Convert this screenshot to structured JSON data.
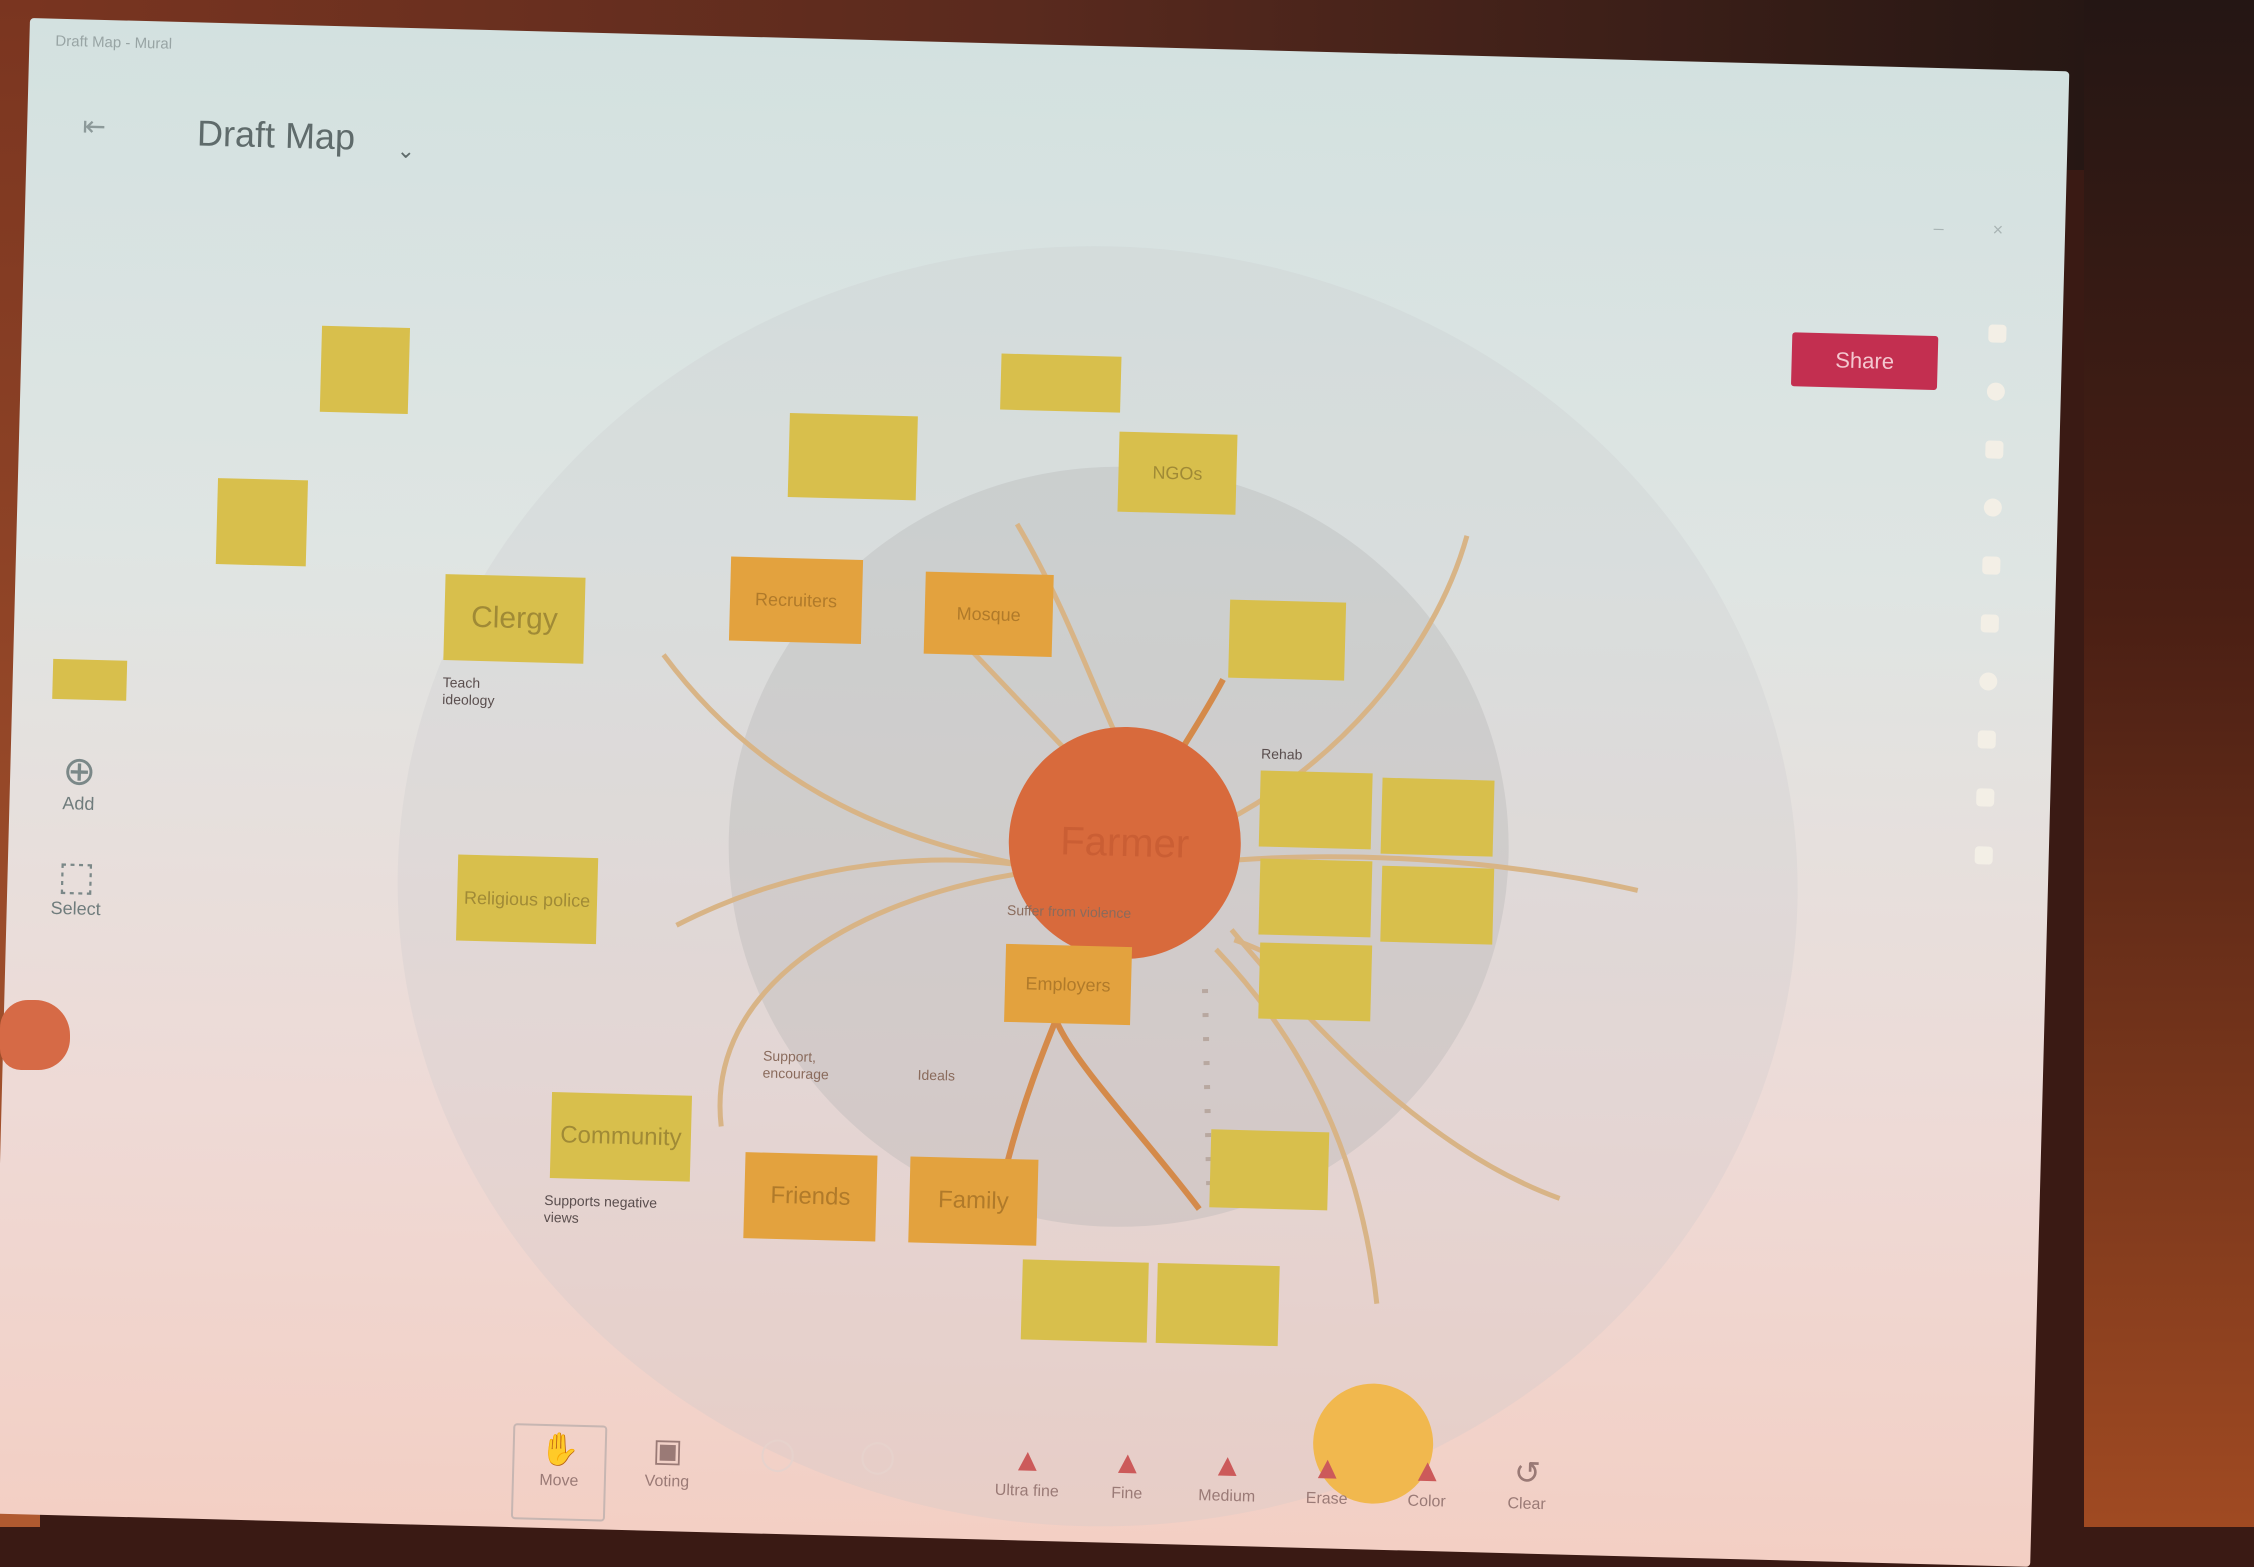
{
  "app": {
    "window_title": "Draft Map - Mural",
    "map_title": "Draft Map",
    "back_icon": "exit-icon",
    "share_button_label": "Share",
    "window_controls": "– ×"
  },
  "left_tools": [
    {
      "label": "Add",
      "icon": "⊕"
    },
    {
      "label": "Select",
      "icon": "⬚"
    }
  ],
  "right_rail_icons": [
    "page-icon",
    "refresh-icon",
    "note-icon",
    "heart-icon",
    "folder-icon",
    "chat-icon",
    "circle-icon",
    "arrow-icon",
    "palette-icon",
    "plus-icon",
    "settings-icon",
    "share-icon",
    "lock-icon",
    "pen-icon",
    "cut-icon",
    "zoom-icon",
    "info-icon"
  ],
  "center": {
    "label": "Farmer"
  },
  "notes": {
    "clergy": "Clergy",
    "religious_police": "Religious police",
    "community": "Community",
    "friends": "Friends",
    "family": "Family",
    "recruiters": "Recruiters",
    "mosque": "Mosque",
    "ngos": "NGOs",
    "employers": "Employers",
    "bottom_left": "",
    "bottom_right": "",
    "top_center": "",
    "top_right": "",
    "right_top": "",
    "right_mid": "",
    "grid_1": "",
    "grid_2": "",
    "grid_3": "",
    "grid_4": "",
    "grid_5": "",
    "blank_1": "",
    "blank_2": ""
  },
  "labels": {
    "teach_ideology": "Teach ideology",
    "supports_negative_views": "Supports negative views",
    "support_encourage": "Support, encourage",
    "ideals": "Ideals",
    "suffer_from_violence": "Suffer from violence",
    "rehab": "Rehab"
  },
  "bottom_bar": [
    {
      "label": "Move",
      "icon": "✋",
      "state": "active"
    },
    {
      "label": "Voting",
      "icon": "▣",
      "state": "normal"
    },
    {
      "label": "",
      "icon": "◯",
      "state": "faded"
    },
    {
      "label": "",
      "icon": "◯",
      "state": "faded"
    },
    {
      "label": "Ultra fine",
      "icon": "▲",
      "state": "pen"
    },
    {
      "label": "Fine",
      "icon": "▲",
      "state": "pen"
    },
    {
      "label": "Medium",
      "icon": "▲",
      "state": "pen"
    },
    {
      "label": "Erase",
      "icon": "▲",
      "state": "pen"
    },
    {
      "label": "Color",
      "icon": "▲",
      "state": "pen"
    },
    {
      "label": "Clear",
      "icon": "↺",
      "state": "normal"
    }
  ],
  "colors": {
    "note_yellow": "#d8bf4c",
    "note_orange": "#e3a23e",
    "center_node": "#d86a3c",
    "share_button": "#c32f50"
  }
}
